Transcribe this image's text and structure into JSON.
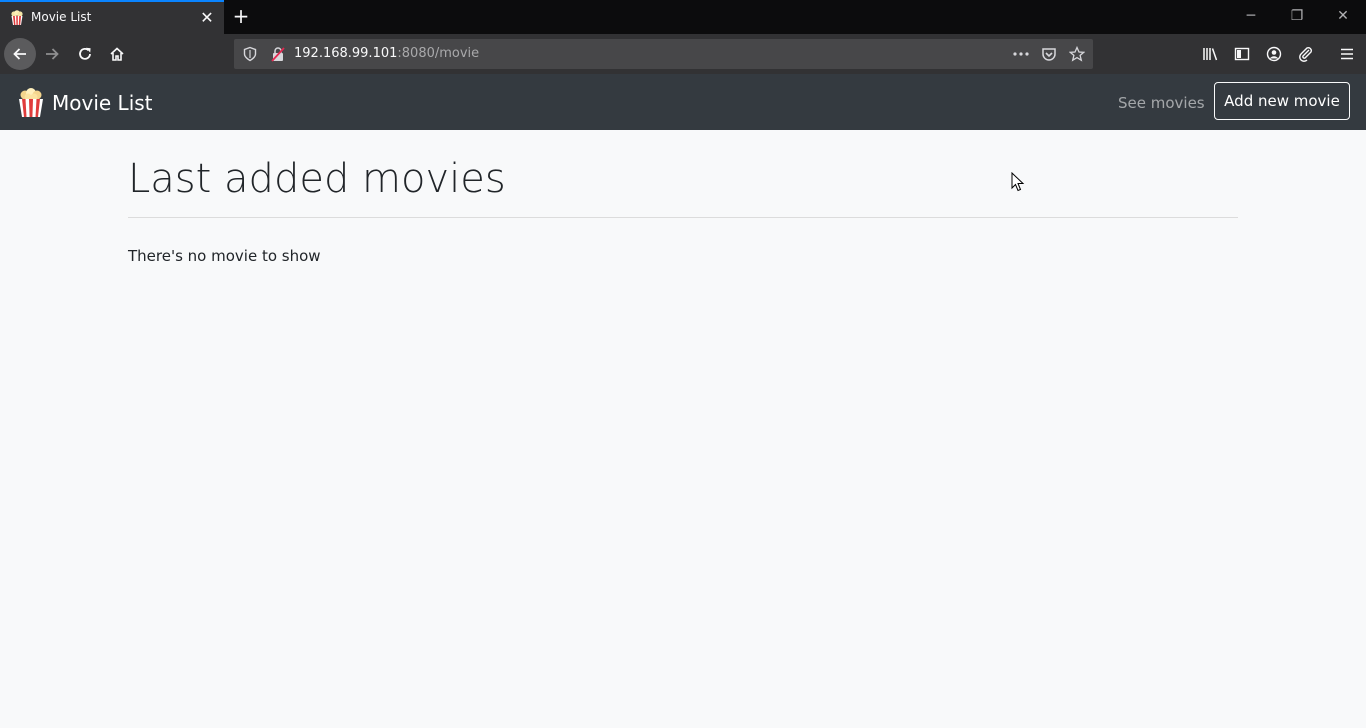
{
  "browser": {
    "tab": {
      "title": "Movie List",
      "close_glyph": "✕",
      "favicon_icon": "popcorn-icon"
    },
    "new_tab_glyph": "+",
    "window": {
      "minimize": "─",
      "restore": "❐",
      "close": "✕"
    },
    "url": {
      "host": "192.168.99.101",
      "rest": ":8080/movie"
    }
  },
  "site": {
    "brand": "Movie List",
    "nav": {
      "see_movies": "See movies",
      "add_new_movie": "Add new movie"
    }
  },
  "main": {
    "title": "Last added movies",
    "empty_message": "There's no movie to show"
  },
  "colors": {
    "tabbar_bg": "#0c0c0d",
    "toolbar_bg": "#323234",
    "site_navbar_bg": "#343a40",
    "page_bg": "#f8f9fa",
    "accent": "#0a84ff"
  }
}
